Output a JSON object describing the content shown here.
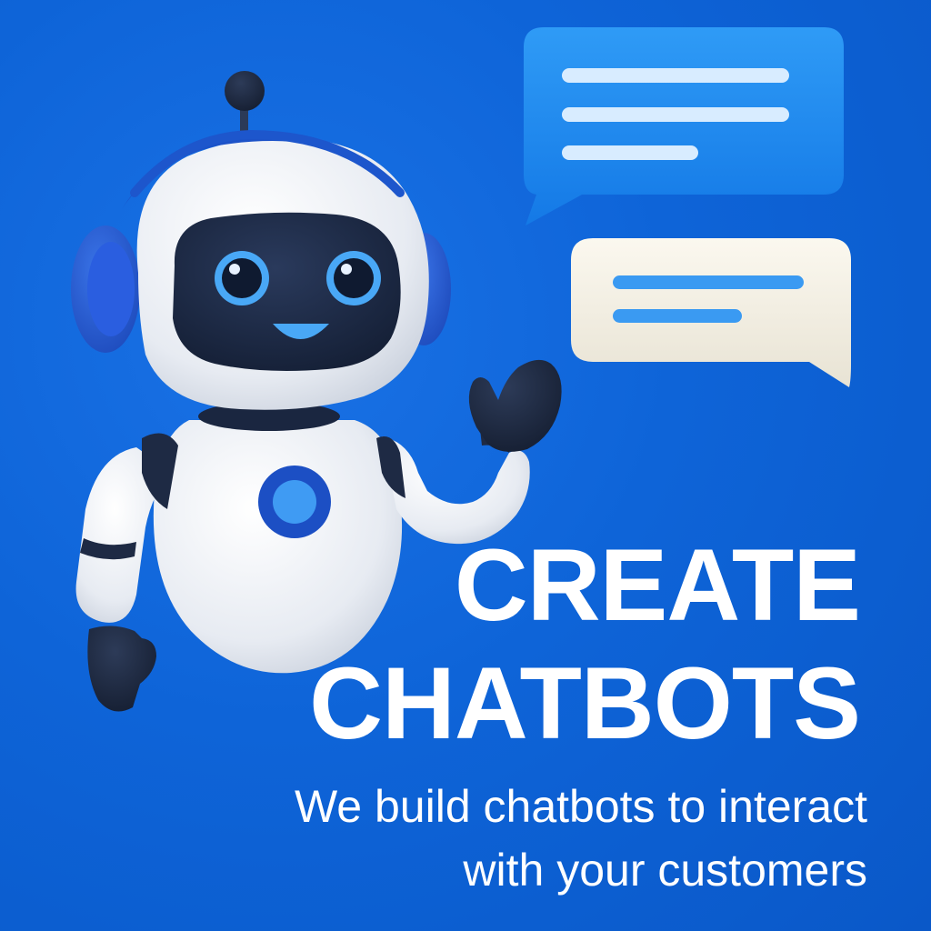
{
  "headline": {
    "line1": "CREATE",
    "line2": "CHATBOTS"
  },
  "tagline": {
    "line1": "We build chatbots to interact",
    "line2": "with your customers"
  },
  "colors": {
    "background": "#0e64d8",
    "accent_blue": "#1e8ef0",
    "cream": "#f1ede2",
    "robot_white": "#eef1f6",
    "robot_dark": "#1b2740",
    "text": "#ffffff"
  },
  "icons": [
    "robot-mascot",
    "chat-bubble-blue",
    "chat-bubble-cream"
  ]
}
